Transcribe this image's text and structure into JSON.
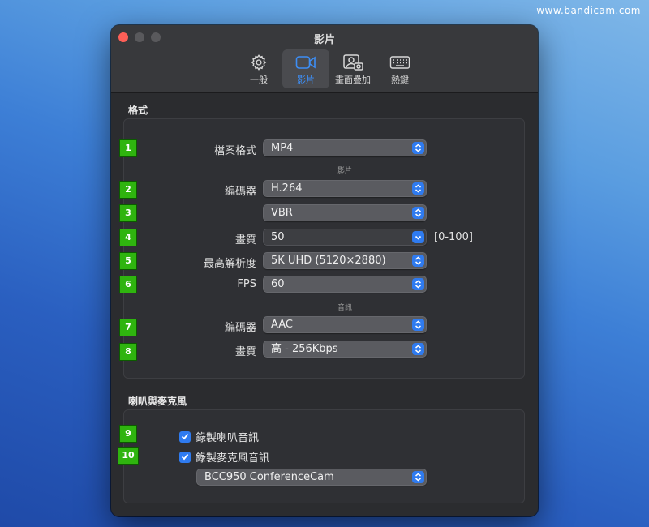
{
  "watermark": "www.bandicam.com",
  "window": {
    "title": "影片"
  },
  "toolbar": {
    "items": [
      {
        "label": "一般",
        "icon": "gear-icon",
        "active": false
      },
      {
        "label": "影片",
        "icon": "video-camera-icon",
        "active": true
      },
      {
        "label": "畫面疊加",
        "icon": "picture-overlay-icon",
        "active": false
      },
      {
        "label": "熱鍵",
        "icon": "keyboard-icon",
        "active": false
      }
    ]
  },
  "format_section": {
    "title": "格式",
    "file_format": {
      "label": "檔案格式",
      "value": "MP4"
    },
    "video_separator": "影片",
    "video_codec": {
      "label": "編碼器",
      "value": "H.264"
    },
    "bitrate_mode": {
      "label": "",
      "value": "VBR"
    },
    "video_quality": {
      "label": "畫質",
      "value": "50",
      "range": "[0-100]"
    },
    "max_resolution": {
      "label": "最高解析度",
      "value": "5K UHD (5120×2880)"
    },
    "fps": {
      "label": "FPS",
      "value": "60"
    },
    "audio_separator": "音訊",
    "audio_codec": {
      "label": "編碼器",
      "value": "AAC"
    },
    "audio_quality": {
      "label": "畫質",
      "value": "高 - 256Kbps"
    }
  },
  "audio_section": {
    "title": "喇叭與麥克風",
    "record_speaker": {
      "label": "錄製喇叭音訊",
      "checked": true
    },
    "record_mic": {
      "label": "錄製麥克風音訊",
      "checked": true
    },
    "mic_device": "BCC950 ConferenceCam"
  },
  "badges": [
    "1",
    "2",
    "3",
    "4",
    "5",
    "6",
    "7",
    "8",
    "9",
    "10"
  ],
  "colors": {
    "accent": "#2f7bf0",
    "active_label": "#3d8ef5",
    "badge_green": "#2fb40f",
    "close_red": "#fe5f57"
  }
}
